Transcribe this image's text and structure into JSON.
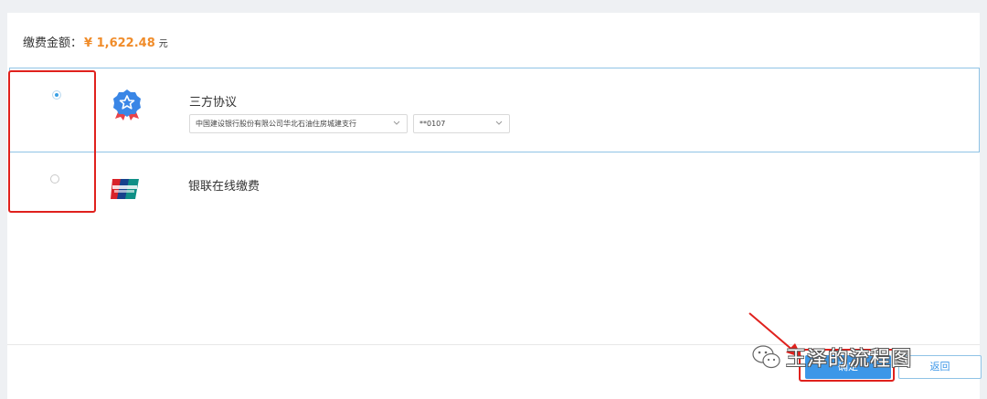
{
  "payment": {
    "amount_label": "缴费金额：",
    "amount_value": "¥ 1,622.48",
    "amount_unit": "元"
  },
  "options": [
    {
      "title": "三方协议",
      "selected": true,
      "icon": "ribbon-star-badge-icon",
      "bank_select_value": "中国建设银行股份有限公司华北石油住房城建支行",
      "card_select_value": "**0107"
    },
    {
      "title": "银联在线缴费",
      "selected": false,
      "icon": "unionpay-card-icon"
    }
  ],
  "actions": {
    "confirm_label": "确定",
    "return_label": "返回"
  },
  "watermark": {
    "text": "王泽的流程图"
  },
  "colors": {
    "accent_blue": "#3c97e8",
    "amount_orange": "#f08c2a",
    "highlight_red": "#e0211d"
  }
}
